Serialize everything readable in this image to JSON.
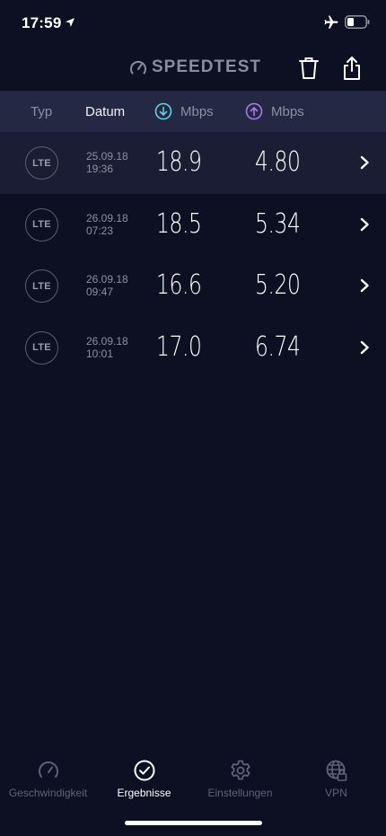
{
  "status_bar": {
    "time": "17:59"
  },
  "header": {
    "logo_text": "SPEEDTEST"
  },
  "columns": {
    "type": "Typ",
    "date": "Datum",
    "download_unit": "Mbps",
    "upload_unit": "Mbps"
  },
  "results": [
    {
      "type": "LTE",
      "date": "25.09.18",
      "time": "19:36",
      "download": "18.9",
      "upload": "4.80",
      "selected": true
    },
    {
      "type": "LTE",
      "date": "26.09.18",
      "time": "07:23",
      "download": "18.5",
      "upload": "5.34",
      "selected": false
    },
    {
      "type": "LTE",
      "date": "26.09.18",
      "time": "09:47",
      "download": "16.6",
      "upload": "5.20",
      "selected": false
    },
    {
      "type": "LTE",
      "date": "26.09.18",
      "time": "10:01",
      "download": "17.0",
      "upload": "6.74",
      "selected": false
    }
  ],
  "tabs": [
    {
      "label": "Geschwindigkeit",
      "icon": "gauge-icon",
      "active": false
    },
    {
      "label": "Ergebnisse",
      "icon": "check-circle-icon",
      "active": true
    },
    {
      "label": "Einstellungen",
      "icon": "gear-icon",
      "active": false
    },
    {
      "label": "VPN",
      "icon": "globe-lock-icon",
      "active": false
    }
  ],
  "colors": {
    "background": "#0d0f22",
    "header_band": "#252842",
    "selected_row": "#1b1d35",
    "download_accent": "#5fd3e0",
    "upload_accent": "#a77bea"
  }
}
